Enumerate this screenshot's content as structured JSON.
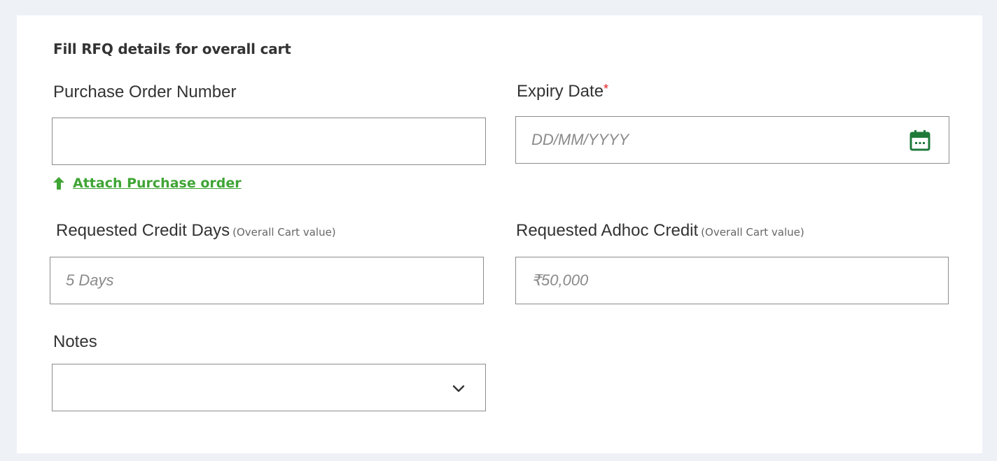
{
  "form": {
    "title": "Fill RFQ details for overall cart",
    "attach_link": "Attach Purchase order",
    "fields": {
      "po_number": {
        "label": "Purchase Order Number",
        "value": "",
        "placeholder": ""
      },
      "expiry_date": {
        "label": "Expiry Date",
        "required_mark": "*",
        "value": "",
        "placeholder": "DD/MM/YYYY",
        "icon": "calendar-icon"
      },
      "credit_days": {
        "label": "Requested Credit Days",
        "hint": "(Overall Cart value)",
        "value": "",
        "placeholder": "5 Days"
      },
      "adhoc_credit": {
        "label": "Requested Adhoc Credit",
        "hint": "(Overall Cart value)",
        "value": "",
        "placeholder": "₹50,000"
      },
      "notes": {
        "label": "Notes",
        "selected": "",
        "icon": "chevron-down-icon"
      }
    }
  },
  "colors": {
    "background": "#eef1f6",
    "card": "#ffffff",
    "accent_green": "#3fa535",
    "icon_green": "#1f7a3a",
    "required_red": "#e02020",
    "border": "#8c8c8c"
  }
}
